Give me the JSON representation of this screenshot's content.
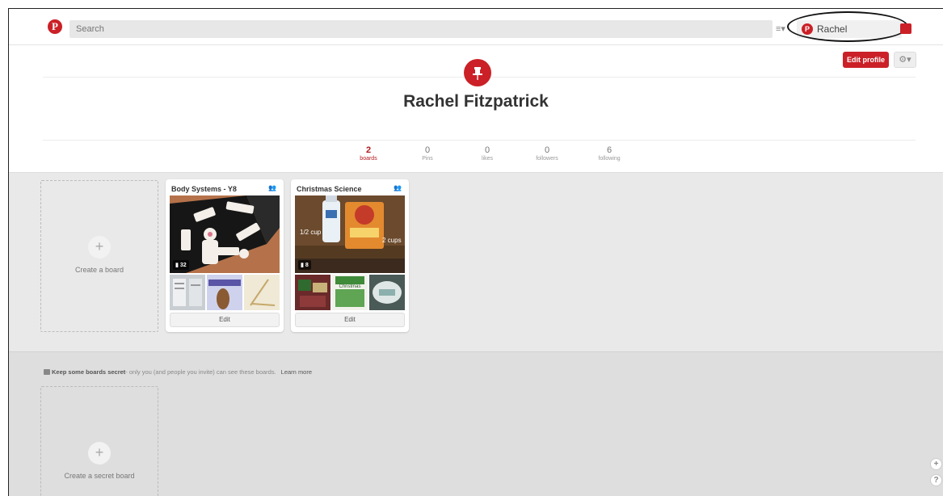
{
  "header": {
    "logo_letter": "P",
    "search_placeholder": "Search",
    "menu_icon": "≡▾",
    "user_name": "Rachel",
    "user_initial": "P"
  },
  "profile": {
    "edit_profile_label": "Edit profile",
    "settings_icon": "⚙▾",
    "name": "Rachel Fitzpatrick",
    "stats": [
      {
        "count": "2",
        "label": "boards"
      },
      {
        "count": "0",
        "label": "Pins"
      },
      {
        "count": "0",
        "label": "likes"
      },
      {
        "count": "0",
        "label": "followers"
      },
      {
        "count": "6",
        "label": "following"
      }
    ]
  },
  "boards": {
    "create_label": "Create a board",
    "items": [
      {
        "title": "Body Systems - Y8",
        "pin_count": "32",
        "edit_label": "Edit"
      },
      {
        "title": "Christmas Science",
        "pin_count": "8",
        "edit_label": "Edit",
        "cover_text_left": "1/2 cup",
        "cover_text_right": "2 cups",
        "thumb_text": "Christmas"
      }
    ]
  },
  "secret": {
    "note_bold": "Keep some boards secret",
    "note_rest": "- only you (and people you invite) can see these boards.",
    "learn_more": "Learn more",
    "create_label": "Create a secret board"
  },
  "corner": {
    "plus": "+",
    "help": "?"
  },
  "colors": {
    "brand_red": "#cb2027",
    "boards_bg": "#e9e9e9"
  }
}
